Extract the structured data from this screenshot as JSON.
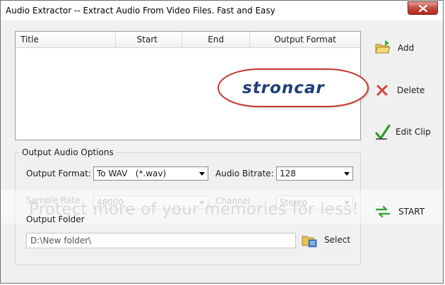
{
  "window": {
    "title": "Audio Extractor -- Extract Audio From Video Files.  Fast and Easy"
  },
  "list": {
    "columns": [
      "Title",
      "Start",
      "End",
      "Output Format"
    ]
  },
  "actions": {
    "add_label": "Add",
    "delete_label": "Delete",
    "edit_label": "Edit Clip",
    "start_label": "START"
  },
  "options": {
    "group_title": "Output Audio Options",
    "output_format_label": "Output Format:",
    "output_format_value": "To WAV   (*.wav)",
    "audio_bitrate_label": "Audio Bitrate:",
    "audio_bitrate_value": "128",
    "sample_rate_label": "Sample Rate",
    "sample_rate_value": "48000",
    "channel_label": "Channel",
    "channel_value": "Stereo",
    "output_folder_label": "Output Folder",
    "output_folder_value": "D:\\New folder\\",
    "select_label": "Select"
  },
  "overlay": {
    "watermark": "Protect more of your memories for less!",
    "logo_text": "stroncar"
  }
}
